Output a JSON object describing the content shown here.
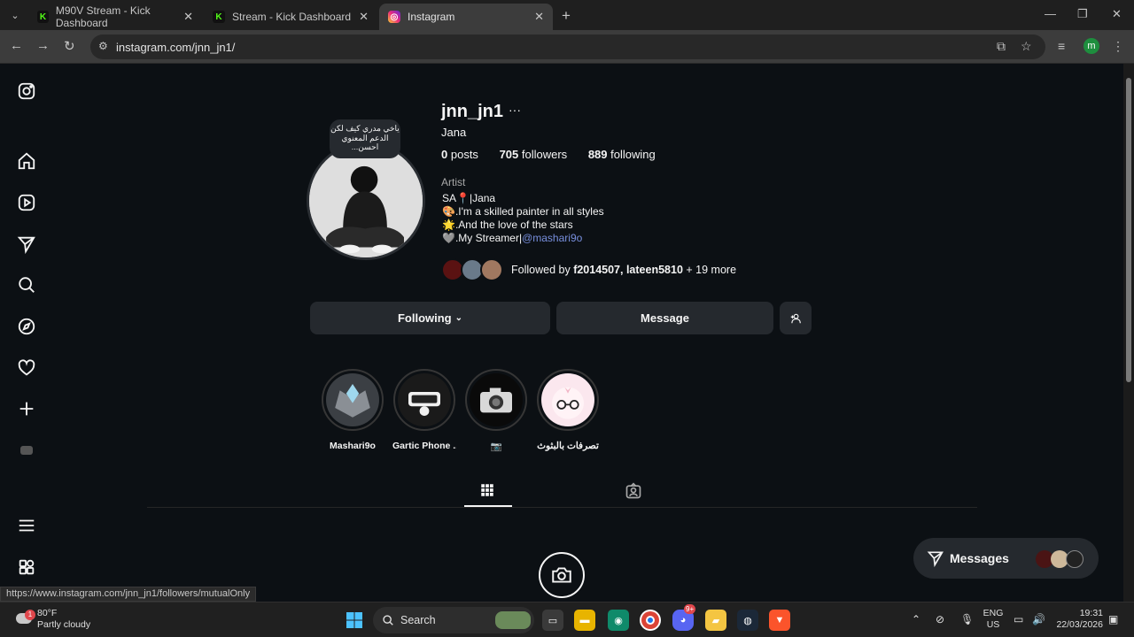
{
  "browser": {
    "tabs": [
      {
        "title": "M90V Stream - Kick Dashboard",
        "favicon": "kick-icon"
      },
      {
        "title": "Stream - Kick Dashboard",
        "favicon": "kick-icon"
      },
      {
        "title": "Instagram",
        "favicon": "instagram-icon",
        "active": true
      }
    ],
    "url": "instagram.com/jnn_jn1/",
    "profile_initial": "m",
    "status_url": "https://www.instagram.com/jnn_jn1/followers/mutualOnly"
  },
  "profile": {
    "username": "jnn_jn1",
    "full_name": "Jana",
    "note": "ياخي مدري كيف لكن الدعم المعنوي احسن...",
    "posts_count": "0",
    "posts_label": "posts",
    "followers_count": "705",
    "followers_label": "followers",
    "following_count": "889",
    "following_label": "following",
    "category": "Artist",
    "bio": [
      "SA📍|Jana",
      "🎨.I'm a skilled painter in all styles",
      "🌟.And the love of the stars",
      "🩶.My Streamer|"
    ],
    "bio_mention": "@mashari9o",
    "followed_by_prefix": "Followed by",
    "followed_by_names": "f2014507, lateen5810",
    "followed_by_more": "+ 19 more"
  },
  "actions": {
    "following_label": "Following",
    "message_label": "Message"
  },
  "highlights": [
    {
      "label": "Mashari9o"
    },
    {
      "label": "Gartic Phone ..."
    },
    {
      "label": "📷"
    },
    {
      "label": "تصرفات بالبثوث"
    }
  ],
  "floating": {
    "messages_label": "Messages"
  },
  "taskbar": {
    "temperature": "80°F",
    "weather": "Partly cloudy",
    "weather_badge": "1",
    "search_label": "Search",
    "lang_top": "ENG",
    "lang_bottom": "US",
    "time": "19:31",
    "date": "22/03/2026",
    "discord_badge": "9+"
  }
}
